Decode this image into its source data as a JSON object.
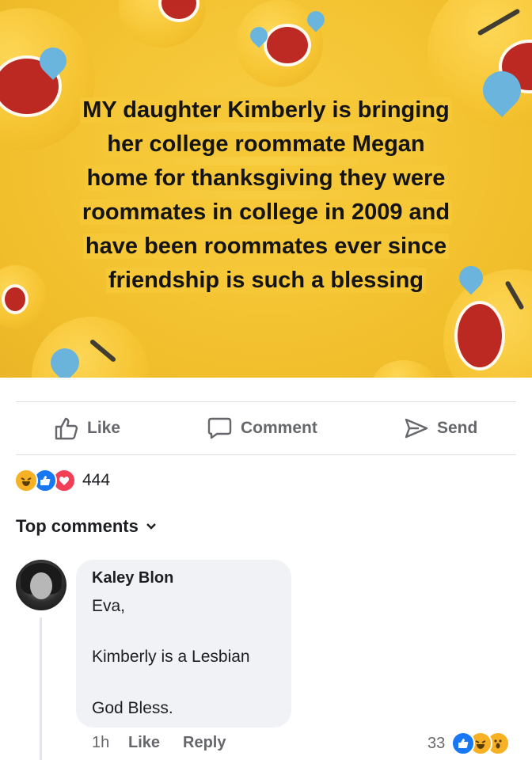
{
  "post": {
    "text_lines": [
      "MY daughter Kimberly is bringing",
      "her college roommate Megan",
      "home for thanksgiving they were",
      "roommates in college in 2009 and",
      "have been roommates ever since",
      "friendship is such a blessing"
    ],
    "background_color": "#f4c233",
    "background_icon": "laughing-emoji-icon"
  },
  "actions": {
    "like_label": "Like",
    "comment_label": "Comment",
    "send_label": "Send"
  },
  "reactions": {
    "icons": [
      "haha-icon",
      "like-icon",
      "love-icon"
    ],
    "count": "444"
  },
  "comments_header": {
    "label": "Top comments",
    "icon": "chevron-down-icon"
  },
  "comment": {
    "author": "Kaley Blon",
    "lines": [
      "Eva,",
      "Kimberly is a Lesbian",
      "God Bless."
    ],
    "time": "1h",
    "like_label": "Like",
    "reply_label": "Reply",
    "reaction_count": "33",
    "reaction_icons": [
      "like-icon",
      "haha-icon",
      "wow-icon"
    ]
  },
  "colors": {
    "like_blue": "#1877f2",
    "love_red": "#f33e58",
    "haha_yellow": "#f7b125",
    "muted_text": "#65676b"
  }
}
